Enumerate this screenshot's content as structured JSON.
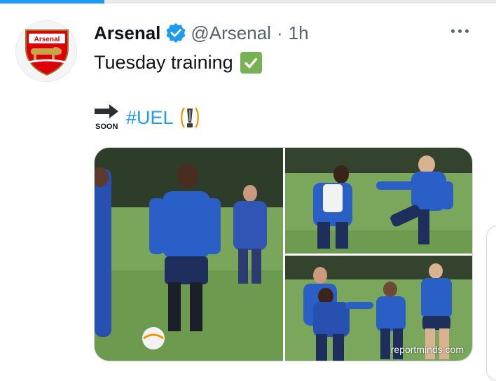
{
  "progress": {
    "fraction": 0.21,
    "color": "#1d9bf0"
  },
  "tweet": {
    "author_name": "Arsenal",
    "handle": "@Arsenal",
    "separator": "·",
    "time": "1h",
    "text": "Tuesday training",
    "soon_label": "SOON",
    "hashtag": "#UEL",
    "avatar_badge_text": "Arsenal"
  },
  "icons": {
    "verified": "verified-badge-icon",
    "check": "check-mark-button-icon",
    "soon": "soon-arrow-icon",
    "uel": "europa-league-trophy-icon",
    "more": "more-icon"
  },
  "media": {
    "watermark": "reportminds.com",
    "photos": [
      {
        "label": "training-photo-saka"
      },
      {
        "label": "training-photo-duo"
      },
      {
        "label": "training-photo-group"
      }
    ]
  },
  "colors": {
    "accent": "#1d9bf0",
    "check_green": "#77b255",
    "arsenal_red": "#db0007",
    "kit_blue": "#2a5fc8"
  }
}
